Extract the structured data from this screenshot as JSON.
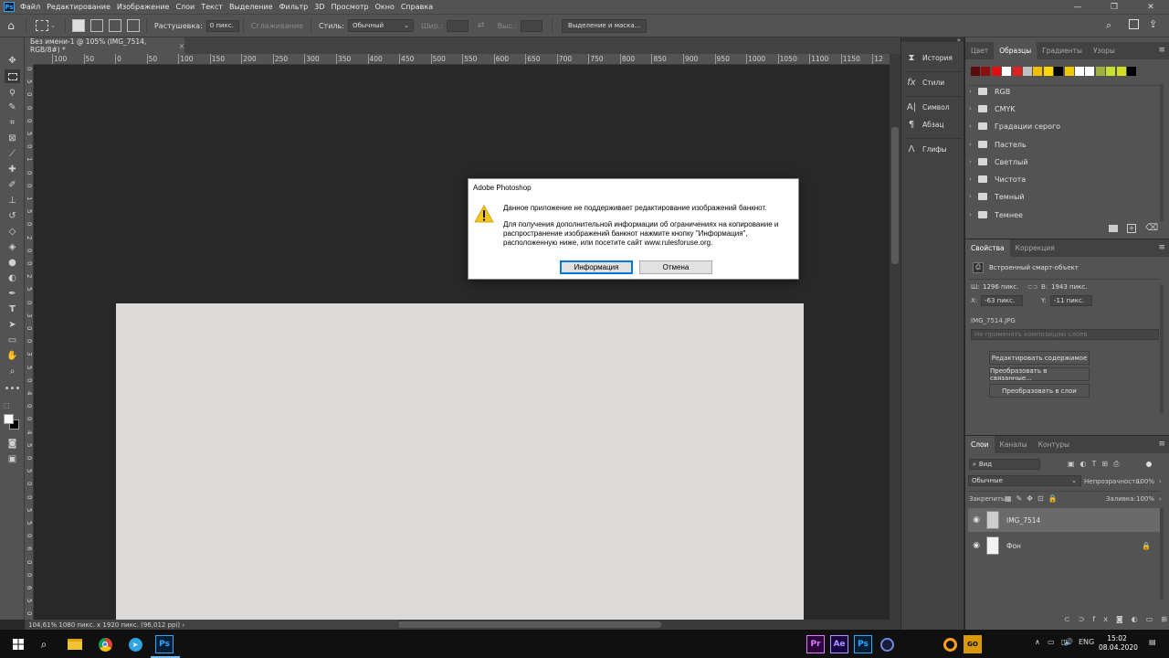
{
  "menubar": {
    "app_icon": "Ps",
    "items": [
      "Файл",
      "Редактирование",
      "Изображение",
      "Слои",
      "Текст",
      "Выделение",
      "Фильтр",
      "3D",
      "Просмотр",
      "Окно",
      "Справка"
    ],
    "window_controls": [
      "minimize-icon",
      "maximize-icon",
      "close-icon"
    ]
  },
  "options": {
    "feather_label": "Растушевка:",
    "feather_value": "0 пикс.",
    "antialias_label": "Сглаживание",
    "style_label": "Стиль:",
    "style_value": "Обычный",
    "width_label": "Шир.:",
    "height_label": "Выс.:",
    "select_mask_label": "Выделение и маска..."
  },
  "document": {
    "tab_title": "Без имени-1 @ 105% (IMG_7514, RGB/8#) *",
    "ruler_h": [
      "100",
      "50",
      "0",
      "50",
      "100",
      "150",
      "200",
      "250",
      "300",
      "350",
      "400",
      "450",
      "500",
      "550",
      "600",
      "650",
      "700",
      "750",
      "800",
      "850",
      "900",
      "950",
      "1000",
      "1050",
      "1100",
      "1150",
      "12"
    ],
    "ruler_v": [
      "0",
      "5",
      "0",
      "0",
      "0",
      "5",
      "0",
      "1",
      "0",
      "0",
      "1",
      "5",
      "0",
      "2",
      "0",
      "0",
      "2",
      "5",
      "0",
      "3",
      "0",
      "0",
      "3",
      "5",
      "0",
      "4",
      "0",
      "0",
      "4",
      "5",
      "0",
      "5",
      "0",
      "0",
      "5",
      "5",
      "0",
      "6",
      "0",
      "0",
      "6",
      "5",
      "0"
    ],
    "status": "104,61%   1080 пикс. x 1920 пикс. (96,012 ppi)   ›"
  },
  "dock": [
    {
      "icon": "history-icon",
      "label": "История"
    },
    {
      "icon": "styles-icon",
      "label": "Стили"
    },
    {
      "icon": "character-icon",
      "label": "Символ"
    },
    {
      "icon": "paragraph-icon",
      "label": "Абзац"
    },
    {
      "icon": "glyphs-icon",
      "label": "Глифы"
    }
  ],
  "swatches_panel": {
    "tabs": [
      "Цвет",
      "Образцы",
      "Градиенты",
      "Узоры"
    ],
    "active_tab": "Образцы",
    "colors": [
      "#5b0b0b",
      "#8a1010",
      "#e01010",
      "#ffffff",
      "#e02020",
      "#c0c0c0",
      "#f0c000",
      "#ffd800",
      "#000000",
      "#f0c800",
      "#ffffff",
      "#ffffff",
      "#a0b040",
      "#c8e030",
      "#d0e020",
      "#000000"
    ],
    "groups": [
      "RGB",
      "CMYK",
      "Градации серого",
      "Пастель",
      "Светлый",
      "Чистота",
      "Темный",
      "Темнее"
    ]
  },
  "properties_panel": {
    "tabs": [
      "Свойства",
      "Коррекция"
    ],
    "active_tab": "Свойства",
    "object_type": "Встроенный смарт-объект",
    "w_label": "Ш:",
    "w_value": "1296 пикс.",
    "h_label": "В:",
    "h_value": "1943 пикс.",
    "x_label": "X:",
    "x_value": "-63 пикс.",
    "y_label": "Y:",
    "y_value": "-11 пикс.",
    "filename": "IMG_7514.JPG",
    "layer_comp_placeholder": "Не применять композицию слоев",
    "buttons": [
      "Редактировать содержимое",
      "Преобразовать в связанные...",
      "Преобразовать в слои"
    ]
  },
  "layers_panel": {
    "tabs": [
      "Слои",
      "Каналы",
      "Контуры"
    ],
    "active_tab": "Слои",
    "filter_label": "Вид",
    "blend_mode": "Обычные",
    "opacity_label": "Непрозрачность:",
    "opacity_value": "100%",
    "lock_label": "Закрепить:",
    "fill_label": "Заливка:",
    "fill_value": "100%",
    "layers": [
      {
        "name": "IMG_7514",
        "selected": true
      },
      {
        "name": "Фон",
        "selected": false
      }
    ]
  },
  "dialog": {
    "title": "Adobe Photoshop",
    "icon": "warning-icon",
    "message": "Данное приложение не поддерживает редактирование изображений банкнот.",
    "details_line1": "Для получения дополнительной информации об ограничениях на копирование и",
    "details_line2": "распространение изображений банкнот нажмите кнопку \"Информация\",",
    "details_line3": "расположенную ниже, или посетите сайт www.rulesforuse.org.",
    "info_button": "Информация",
    "cancel_button": "Отмена"
  },
  "taskbar": {
    "apps": [
      {
        "icon": "windows-start-icon",
        "label": ""
      },
      {
        "icon": "search-icon",
        "label": ""
      },
      {
        "icon": "file-explorer-icon",
        "label": ""
      },
      {
        "icon": "chrome-icon",
        "label": ""
      },
      {
        "icon": "telegram-icon",
        "label": ""
      },
      {
        "icon": "photoshop-icon",
        "label": "Ps"
      },
      {
        "icon": "premiere-icon",
        "label": "Pr"
      },
      {
        "icon": "after-effects-icon",
        "label": "Ae"
      },
      {
        "icon": "photoshop-icon-2",
        "label": "Ps"
      },
      {
        "icon": "cinema4d-icon",
        "label": ""
      },
      {
        "icon": "overwatch-icon",
        "label": ""
      },
      {
        "icon": "csgo-icon",
        "label": "GO"
      }
    ],
    "language": "ENG",
    "time": "15:02",
    "date": "08.04.2020"
  }
}
